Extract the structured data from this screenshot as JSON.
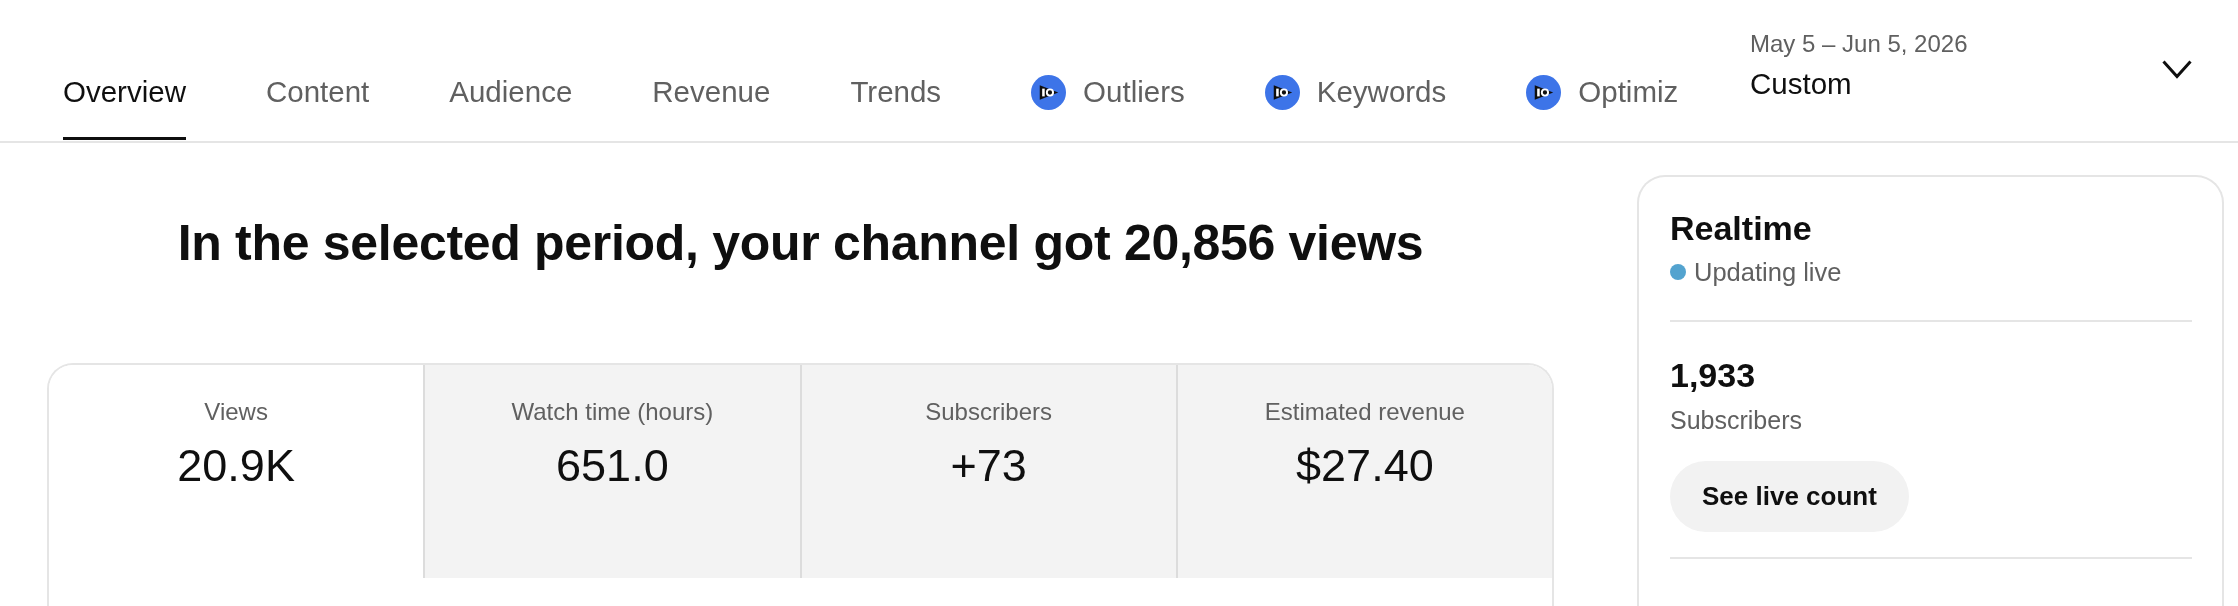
{
  "tabs": [
    {
      "label": "Overview",
      "selected": true,
      "kind": "standard"
    },
    {
      "label": "Content",
      "selected": false,
      "kind": "standard"
    },
    {
      "label": "Audience",
      "selected": false,
      "kind": "standard"
    },
    {
      "label": "Revenue",
      "selected": false,
      "kind": "standard"
    },
    {
      "label": "Trends",
      "selected": false,
      "kind": "standard"
    },
    {
      "label": "Outliers",
      "selected": false,
      "kind": "extension"
    },
    {
      "label": "Keywords",
      "selected": false,
      "kind": "extension"
    },
    {
      "label": "Optimiz",
      "selected": false,
      "kind": "extension"
    }
  ],
  "date_range": {
    "range": "May 5 – Jun 5, 2026",
    "preset": "Custom"
  },
  "headline": "In the selected period, your channel got 20,856 views",
  "metrics": [
    {
      "label": "Views",
      "value": "20.9K",
      "selected": true
    },
    {
      "label": "Watch time (hours)",
      "value": "651.0",
      "selected": false
    },
    {
      "label": "Subscribers",
      "value": "+73",
      "selected": false
    },
    {
      "label": "Estimated revenue",
      "value": "$27.40",
      "selected": false
    }
  ],
  "realtime": {
    "title": "Realtime",
    "status": "Updating live",
    "stat_value": "1,933",
    "stat_label": "Subscribers",
    "button": "See live count"
  }
}
